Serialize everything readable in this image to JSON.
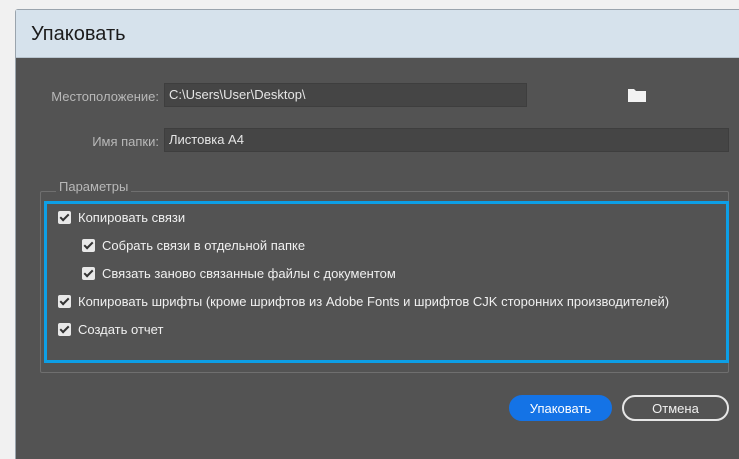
{
  "dialog": {
    "title": "Упаковать"
  },
  "location": {
    "label": "Местоположение:",
    "value": "C:\\Users\\User\\Desktop\\",
    "browse_icon": "folder-icon"
  },
  "folder_name": {
    "label": "Имя папки:",
    "value": "Листовка A4"
  },
  "options": {
    "group_title": "Параметры",
    "items": [
      {
        "label": "Копировать связи",
        "checked": true
      },
      {
        "label": "Собрать связи в отдельной папке",
        "checked": true
      },
      {
        "label": "Связать заново связанные файлы с документом",
        "checked": true
      },
      {
        "label": "Копировать шрифты (кроме шрифтов из Adobe Fonts и шрифтов CJK сторонних производителей)",
        "checked": true
      },
      {
        "label": "Создать отчет",
        "checked": true
      }
    ]
  },
  "buttons": {
    "package_label": "Упаковать",
    "cancel_label": "Отмена"
  },
  "colors": {
    "panel": "#535353",
    "titlebar": "#d6e2ec",
    "accent": "#1473e6",
    "highlight": "#0d9fe6"
  }
}
